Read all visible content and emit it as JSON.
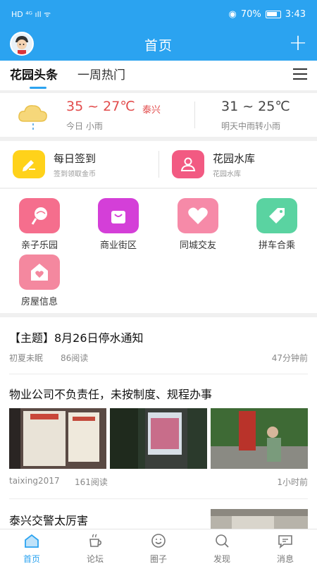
{
  "status_bar": {
    "left_icons": "HD ⁴ᴳ ıll ᯤ",
    "battery": "70%",
    "time": "3:43"
  },
  "app_bar": {
    "title": "首页"
  },
  "tabs": [
    {
      "label": "花园头条",
      "active": true
    },
    {
      "label": "一周热门",
      "active": false
    }
  ],
  "weather": {
    "today_temp": "35 ~ 27℃",
    "today_city": "泰兴",
    "today_desc": "今日 小雨",
    "tomorrow_temp": "31 ~ 25℃",
    "tomorrow_desc": "明天中雨转小雨"
  },
  "quick_links": [
    {
      "title": "每日签到",
      "subtitle": "签到领取金币",
      "icon": "pencil-icon",
      "color": "#ffd21a"
    },
    {
      "title": "花园水库",
      "subtitle": "花园水库",
      "icon": "user-icon",
      "color": "#f25a82"
    }
  ],
  "grid": [
    {
      "label": "亲子乐园",
      "icon": "lollipop-icon",
      "color": "#f56e8d"
    },
    {
      "label": "商业街区",
      "icon": "shopping-bag-icon",
      "color": "#d43fd8"
    },
    {
      "label": "同城交友",
      "icon": "heart-icon",
      "color": "#f68aa8"
    },
    {
      "label": "拼车合乘",
      "icon": "tag-icon",
      "color": "#5ad3a1"
    },
    {
      "label": "房屋信息",
      "icon": "house-heart-icon",
      "color": "#f4889f"
    }
  ],
  "feed": {
    "post1": {
      "title": "【主题】8月26日停水通知",
      "author": "初夏未眠",
      "reads": "86阅读",
      "time": "47分钟前"
    },
    "post2": {
      "title": "物业公司不负责任，未按制度、规程办事",
      "author": "taixing2017",
      "reads": "161阅读",
      "time": "1小时前"
    },
    "post3": {
      "title": "泰兴交警太厉害"
    }
  },
  "bottom_nav": [
    {
      "label": "首页",
      "icon": "home-icon",
      "active": true
    },
    {
      "label": "论坛",
      "icon": "coffee-cup-icon",
      "active": false
    },
    {
      "label": "圈子",
      "icon": "smile-icon",
      "active": false
    },
    {
      "label": "发现",
      "icon": "search-icon",
      "active": false
    },
    {
      "label": "消息",
      "icon": "chat-icon",
      "active": false
    }
  ],
  "colors": {
    "primary": "#2ba3f0",
    "temp_today": "#e24b4b"
  }
}
